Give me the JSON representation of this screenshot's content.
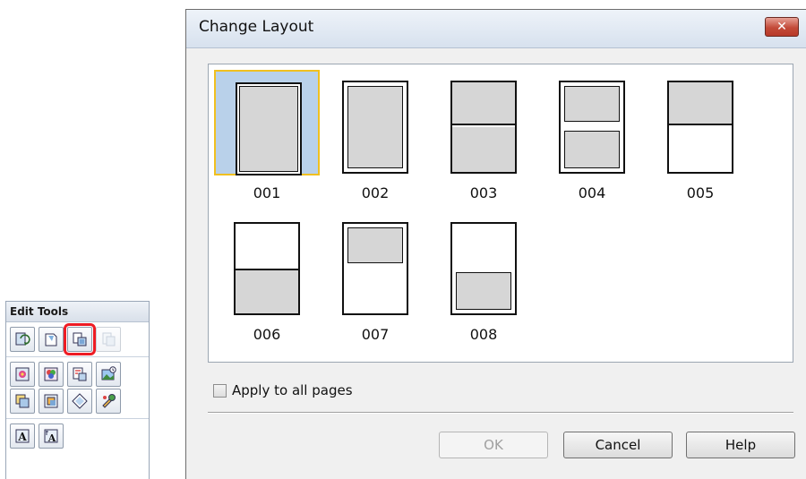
{
  "edit_tools": {
    "title": "Edit Tools",
    "groups": [
      [
        "layout-tool-icon",
        "background-tool-icon",
        "change-layout-icon",
        "disabled-tool-icon"
      ],
      [
        "image-edit-icon",
        "color-adjust-icon",
        "frame-icon",
        "photo-insert-icon",
        "crop-icon",
        "trim-icon",
        "rotate-icon",
        "effect-icon"
      ],
      [
        "text-icon",
        "vertical-text-icon"
      ]
    ],
    "selected": "change-layout-icon",
    "highlight_color": "#ee1c24"
  },
  "dialog": {
    "title": "Change Layout",
    "close_icon": "close-icon",
    "layouts": [
      {
        "label": "001",
        "selected": true
      },
      {
        "label": "002",
        "selected": false
      },
      {
        "label": "003",
        "selected": false
      },
      {
        "label": "004",
        "selected": false
      },
      {
        "label": "005",
        "selected": false
      },
      {
        "label": "006",
        "selected": false
      },
      {
        "label": "007",
        "selected": false
      },
      {
        "label": "008",
        "selected": false
      }
    ],
    "apply_to_all_label": "Apply to all pages",
    "apply_to_all_checked": false,
    "buttons": {
      "ok": "OK",
      "cancel": "Cancel",
      "help": "Help"
    },
    "colors": {
      "selection_fill": "#b9d1ea",
      "selection_border": "#f0c020",
      "placeholder": "#d6d6d6"
    }
  }
}
